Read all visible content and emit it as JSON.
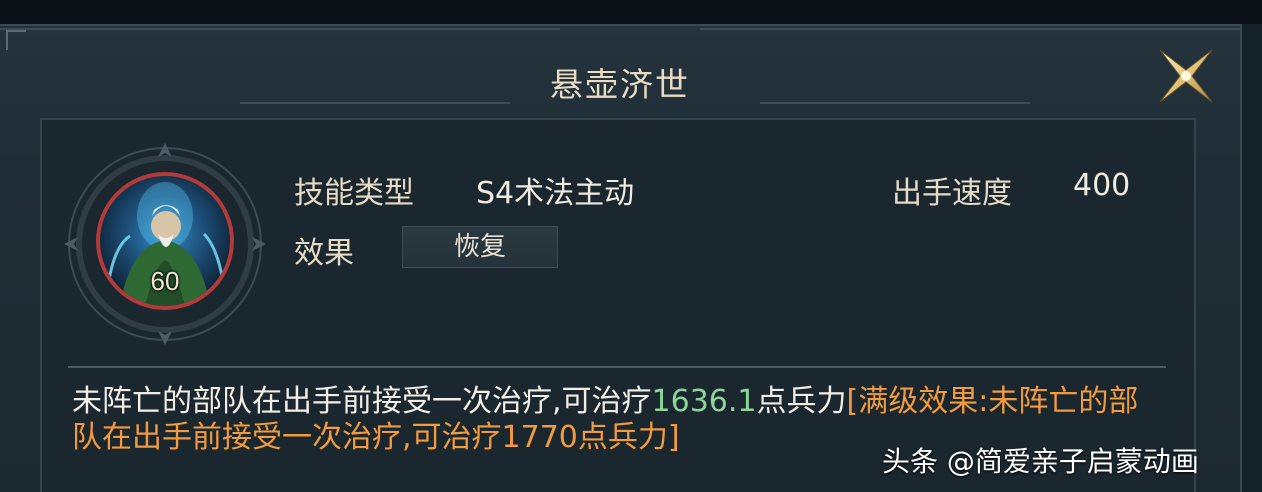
{
  "skill": {
    "title": "悬壶济世",
    "level": "60",
    "type_label": "技能类型",
    "type_value": "S4术法主动",
    "speed_label": "出手速度",
    "speed_value": "400",
    "effect_label": "效果",
    "effect_value": "恢复"
  },
  "description": {
    "part1": "未阵亡的部队在出手前接受一次治疗,可治疗",
    "heal_value": "1636.1",
    "part2": "点兵力",
    "max_effect": "[满级效果:未阵亡的部队在出手前接受一次治疗,可治疗1770点兵力]"
  },
  "watermark": {
    "text": "头条 @简爱亲子启蒙动画"
  },
  "colors": {
    "title": "#e8dcc2",
    "heal_value": "#8dd39a",
    "max_effect": "#f29a3e",
    "portrait_ring": "#b23a3a"
  },
  "icons": {
    "close": "close-x-icon",
    "portrait": "skill-portrait-icon"
  }
}
